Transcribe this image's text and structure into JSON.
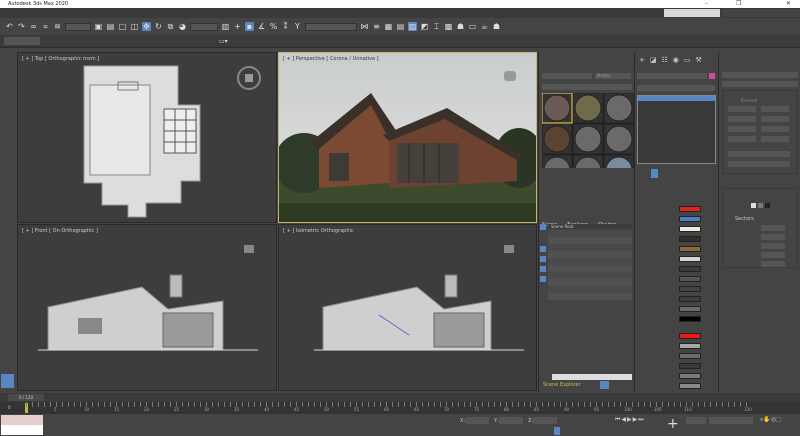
{
  "app": {
    "title": "Autodesk 3ds Max 2020",
    "window_controls": [
      "–",
      "❐",
      "✕"
    ]
  },
  "viewports": [
    {
      "label": "[ + ] Top [ Orthographic mxm ]"
    },
    {
      "label": "[ + ] Perspective [ Corona / Unnative ]"
    },
    {
      "label": "[ + ] Front [ On Orthographic ]"
    },
    {
      "label": "[ + ] Isometric Orthographic"
    }
  ],
  "material_editor": {
    "dropdown": "Mattes"
  },
  "scene_explorer": {
    "tabs": [
      "Scene",
      "Explorer",
      "Shades"
    ],
    "header": "Scene Root",
    "rows": 10,
    "footer": "Scene Explorer"
  },
  "command_panel": {
    "swatches_top": [
      "#e0231d",
      "#4a7fc6",
      "#f0ece0",
      "#2e2e2e",
      "#8b6a38",
      "#d6d6d6",
      "#3a3a3a",
      "#555555",
      "#444444",
      "#3e3e3e",
      "#6a6a6a",
      "#000000"
    ],
    "swatches_bottom": [
      "#e41b17",
      "#a8a8a8",
      "#6c6c6c",
      "#3a3a3a",
      "#7a7a7a",
      "#8a8a8a"
    ]
  },
  "right_panel": {
    "section": "Sectors",
    "group": "Element"
  },
  "timeline": {
    "frame_start": "0",
    "frame_labels": [
      "5",
      "10",
      "15",
      "20",
      "25",
      "30",
      "35",
      "40",
      "45",
      "50",
      "55",
      "60",
      "65",
      "70",
      "75",
      "80",
      "85",
      "90",
      "95",
      "100",
      "105",
      "110",
      "120"
    ],
    "slider_value": "0 / 120"
  },
  "status": {
    "x_label": "X:",
    "y_label": "Y:",
    "z_label": "Z:"
  }
}
